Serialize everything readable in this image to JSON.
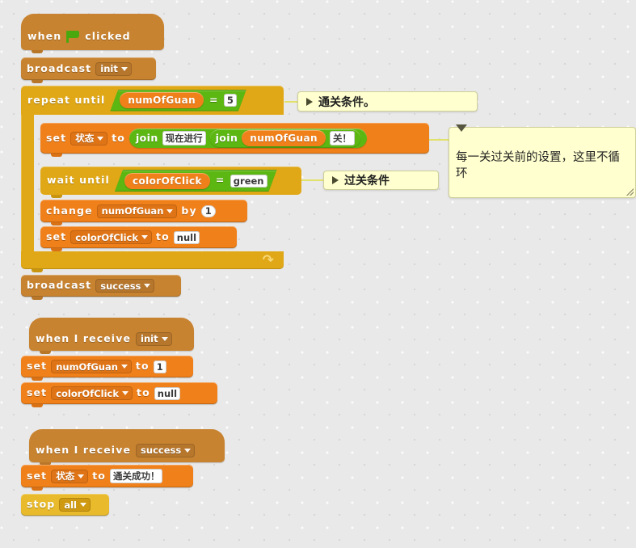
{
  "editor": {
    "name": "scratch-block-canvas",
    "background_color": "#e9e9e9"
  },
  "colors": {
    "events": "#c88330",
    "control": "#e0a817",
    "data": "#f0801a",
    "operators": "#5cb712",
    "comment": "#ffffcf",
    "flag_green": "#4aa80f"
  },
  "scripts": [
    {
      "id": "main-script",
      "blocks": {
        "when_flag_clicked": {
          "when": "when",
          "clicked": "clicked",
          "icon": "green-flag-icon"
        },
        "broadcast_init": {
          "label": "broadcast",
          "message": "init"
        },
        "repeat_until": {
          "label": "repeat until",
          "condition": {
            "left_variable": "numOfGuan",
            "operator": "=",
            "right_value": "5"
          }
        },
        "set_status_join": {
          "label": "set",
          "variable": "状态",
          "to": "to",
          "join_outer": "join",
          "join_outer_text": "现在进行",
          "join_inner": "join",
          "join_inner_variable": "numOfGuan",
          "join_inner_text": "关！"
        },
        "wait_until": {
          "label": "wait until",
          "condition": {
            "left_variable": "colorOfClick",
            "operator": "=",
            "right_value": "green"
          }
        },
        "change_num": {
          "label": "change",
          "variable": "numOfGuan",
          "by": "by",
          "value": "1"
        },
        "set_color_null": {
          "label": "set",
          "variable": "colorOfClick",
          "to": "to",
          "value": "null"
        },
        "broadcast_success": {
          "label": "broadcast",
          "message": "success"
        }
      }
    },
    {
      "id": "init-script",
      "blocks": {
        "when_receive": {
          "label": "when I receive",
          "message": "init"
        },
        "set_num": {
          "label": "set",
          "variable": "numOfGuan",
          "to": "to",
          "value": "1"
        },
        "set_color": {
          "label": "set",
          "variable": "colorOfClick",
          "to": "to",
          "value": "null"
        }
      }
    },
    {
      "id": "success-script",
      "blocks": {
        "when_receive": {
          "label": "when I receive",
          "message": "success"
        },
        "set_status": {
          "label": "set",
          "variable": "状态",
          "to": "to",
          "value": "通关成功！"
        },
        "stop": {
          "label": "stop",
          "option": "all"
        }
      }
    }
  ],
  "comments": [
    {
      "id": "comment-pass-condition",
      "state": "collapsed",
      "text": "通关条件。"
    },
    {
      "id": "comment-clear-condition",
      "state": "collapsed",
      "text": "过关条件"
    },
    {
      "id": "comment-per-level-setup",
      "state": "expanded",
      "text": "每一关过关前的设置，这里不循环"
    }
  ]
}
